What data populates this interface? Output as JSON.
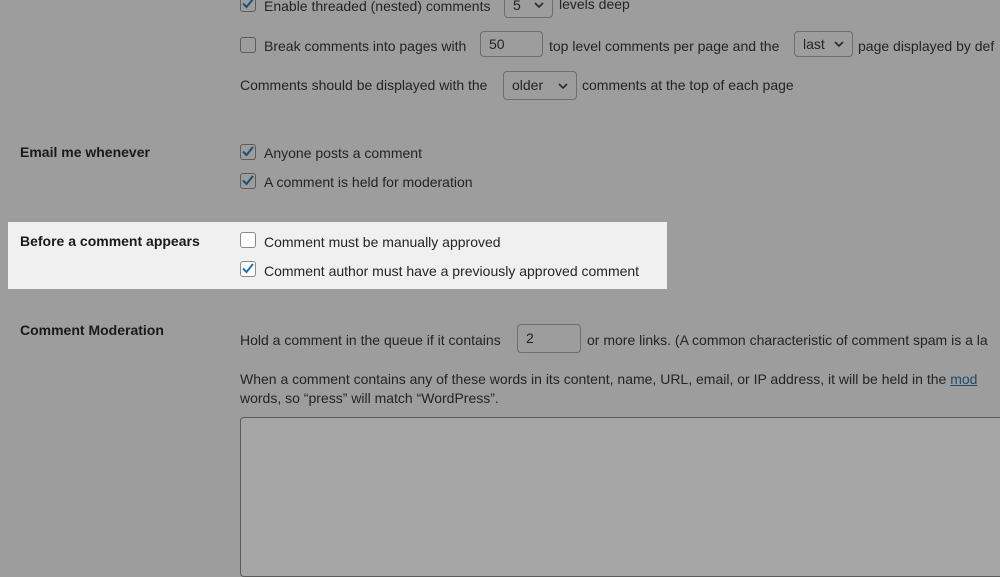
{
  "discussion": {
    "threaded": {
      "checked": true,
      "label": "Enable threaded (nested) comments",
      "depth_value": "5",
      "suffix": "levels deep"
    },
    "paging": {
      "checked": false,
      "label": "Break comments into pages with",
      "per_page_value": "50",
      "middle_text": "top level comments per page and the",
      "page_select_value": "last",
      "suffix": "page displayed by def"
    },
    "order": {
      "prefix": "Comments should be displayed with the",
      "order_select_value": "older",
      "suffix": "comments at the top of each page"
    }
  },
  "email_me": {
    "label": "Email me whenever",
    "options": [
      {
        "label": "Anyone posts a comment",
        "checked": true
      },
      {
        "label": "A comment is held for moderation",
        "checked": true
      }
    ]
  },
  "before_appears": {
    "label": "Before a comment appears",
    "options": [
      {
        "label": "Comment must be manually approved",
        "checked": false
      },
      {
        "label": "Comment author must have a previously approved comment",
        "checked": true
      }
    ]
  },
  "moderation": {
    "label": "Comment Moderation",
    "hold_prefix": "Hold a comment in the queue if it contains",
    "links_value": "2",
    "hold_suffix": "or more links. (A common characteristic of comment spam is a la",
    "words_text": "When a comment contains any of these words in its content, name, URL, email, or IP address, it will be held in the ",
    "words_link": "mod",
    "words_text_line2": "words, so “press” will match “WordPress”.",
    "keys_value": ""
  },
  "colors": {
    "overlay_bg": "#9d9d9d",
    "spotlight_bg": "#f0f0f0",
    "check_blue": "#2271b1"
  }
}
